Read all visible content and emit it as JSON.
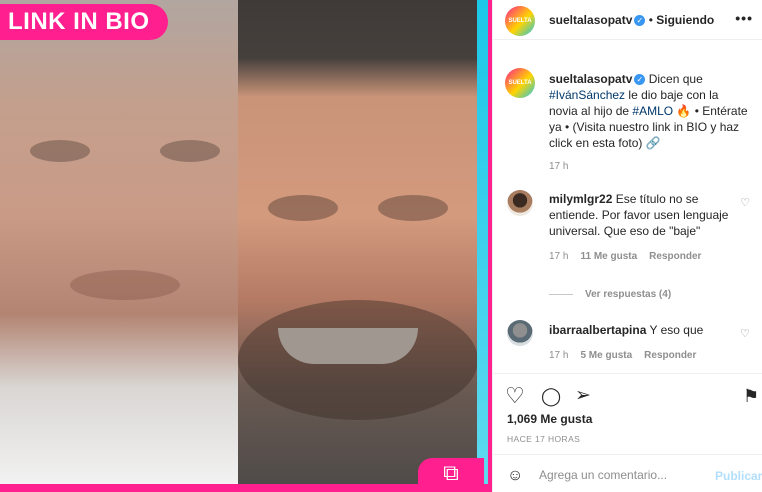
{
  "media": {
    "link_badge": "LINK IN BIO",
    "chain_glyph": "⧉"
  },
  "account": {
    "avatar_text": "SUELTA",
    "username": "sueltalasopatv",
    "verified_glyph": "✓",
    "separator": "•",
    "follow_label": "Siguiendo",
    "more_glyph": "•••"
  },
  "caption": {
    "username": "sueltalasopatv",
    "text_1": " Dicen que ",
    "hashtag_1": "#IvánSánchez",
    "text_2": " le dio baje con la novia al hijo de ",
    "hashtag_2": "#AMLO",
    "text_3": " 🔥 • Entérate ya • (Visita nuestro link in BIO y haz click en esta foto) 🔗",
    "time": "17 h"
  },
  "comments": [
    {
      "username": "milymlgr22",
      "text": " Ese título no se entiende. Por favor usen lenguaje universal. Que eso de \"baje\"",
      "time": "17 h",
      "likes": "11 Me gusta",
      "reply": "Responder",
      "view_replies": "Ver respuestas (4)"
    },
    {
      "username": "ibarraalbertapina",
      "text": " Y eso que",
      "time": "17 h",
      "likes": "5 Me gusta",
      "reply": "Responder"
    }
  ],
  "icons": {
    "heart": "♡",
    "comment": "◯",
    "share": "➢",
    "save": "⚑",
    "emoji": "☺"
  },
  "post": {
    "likes": "1,069 Me gusta",
    "time_ago": "HACE 17 HORAS"
  },
  "composer": {
    "placeholder": "Agrega un comentario...",
    "publish_label": "Publicar"
  }
}
